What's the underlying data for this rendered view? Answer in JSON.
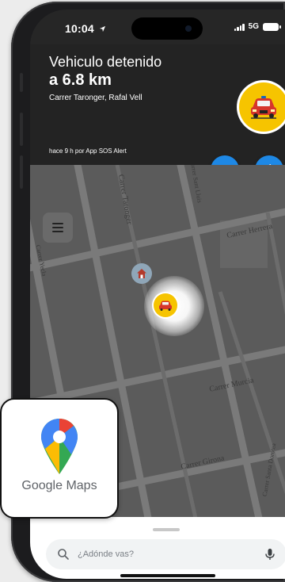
{
  "status_bar": {
    "time": "10:04",
    "network": "5G"
  },
  "alert": {
    "title": "Vehiculo detenido",
    "distance": "a 6.8 km",
    "address": "Carrer Taronger, Rafal Vell",
    "source": "hace 9 h por App SOS Alert"
  },
  "map": {
    "streets": [
      "Carrer Taronger",
      "Carrer Yecla",
      "Carrer Herrera",
      "Carrer Murcia",
      "Carrer Girona",
      "Carrer Sant Lluis",
      "Carrer Santa Dorotea"
    ]
  },
  "search": {
    "placeholder": "¿Adónde vas?"
  },
  "logo": {
    "text": "Google Maps"
  },
  "colors": {
    "accent_yellow": "#f6c400",
    "fab_blue": "#1e88e5",
    "header_bg": "#232323",
    "map_bg": "#5b5b5b"
  },
  "icons": {
    "message_button": "message-icon",
    "like_button": "thumbs-up-icon",
    "menu": "hamburger-menu-icon",
    "mic": "microphone-icon",
    "search": "search-icon"
  }
}
